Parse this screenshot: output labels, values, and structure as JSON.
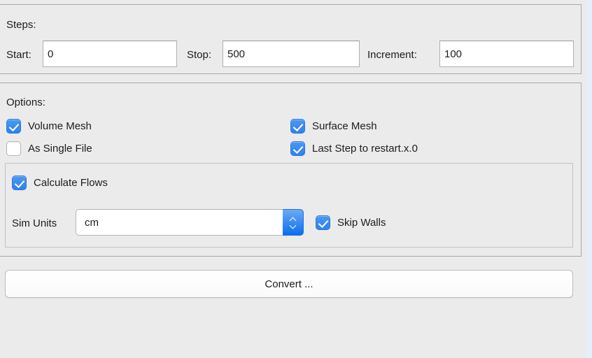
{
  "steps": {
    "section_label": "Steps:",
    "start": {
      "label": "Start:",
      "value": "0"
    },
    "stop": {
      "label": "Stop:",
      "value": "500"
    },
    "increment": {
      "label": "Increment:",
      "value": "100"
    }
  },
  "options": {
    "section_label": "Options:",
    "volume_mesh": {
      "label": "Volume Mesh",
      "checked": true
    },
    "as_single_file": {
      "label": "As Single File",
      "checked": false
    },
    "surface_mesh": {
      "label": "Surface Mesh",
      "checked": true
    },
    "last_step": {
      "label": "Last Step to restart.x.0",
      "checked": true
    },
    "flows": {
      "calculate_flows": {
        "label": "Calculate Flows",
        "checked": true
      },
      "sim_units": {
        "label": "Sim Units",
        "value": "cm"
      },
      "skip_walls": {
        "label": "Skip Walls",
        "checked": true
      }
    }
  },
  "actions": {
    "convert_label": "Convert ..."
  },
  "colors": {
    "window_background": "#ebebeb",
    "accent_checkbox": "#3c8cf0",
    "stepper_top": "#6aaaf5",
    "stepper_bottom": "#0a6ef0",
    "group_border": "#a9a9a9",
    "field_border": "#b0b0b0",
    "text": "#1c1c1e",
    "edge_strip": "#e6eefa"
  }
}
